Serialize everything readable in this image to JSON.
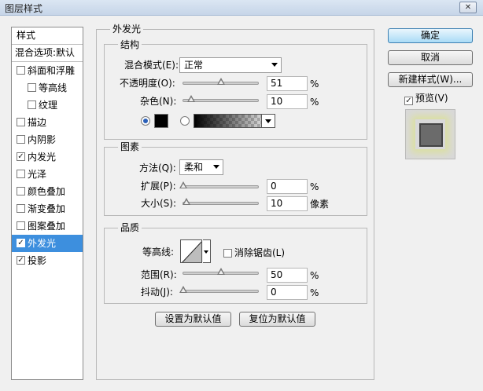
{
  "window": {
    "title": "图层样式",
    "close_icon": "close-icon"
  },
  "left_panel": {
    "header": "样式",
    "blending_options": "混合选项:默认",
    "items": [
      {
        "label": "斜面和浮雕",
        "checked": false
      },
      {
        "label": "等高线",
        "checked": false,
        "sub": true
      },
      {
        "label": "纹理",
        "checked": false,
        "sub": true
      },
      {
        "label": "描边",
        "checked": false
      },
      {
        "label": "内阴影",
        "checked": false
      },
      {
        "label": "内发光",
        "checked": true
      },
      {
        "label": "光泽",
        "checked": false
      },
      {
        "label": "颜色叠加",
        "checked": false
      },
      {
        "label": "渐变叠加",
        "checked": false
      },
      {
        "label": "图案叠加",
        "checked": false
      },
      {
        "label": "外发光",
        "checked": true,
        "selected": true
      },
      {
        "label": "投影",
        "checked": true
      }
    ],
    "check_mark": "✓"
  },
  "outer_glow": {
    "title": "外发光",
    "structure": {
      "title": "结构",
      "blend_mode_label": "混合模式(E):",
      "blend_mode_value": "正常",
      "opacity_label": "不透明度(O):",
      "opacity_value": "51",
      "opacity_unit": "%",
      "opacity_fraction": 0.51,
      "noise_label": "杂色(N):",
      "noise_value": "10",
      "noise_unit": "%",
      "noise_fraction": 0.1,
      "color_mode": "solid",
      "glow_color": "#000000"
    },
    "elements": {
      "title": "图素",
      "technique_label": "方法(Q):",
      "technique_value": "柔和",
      "spread_label": "扩展(P):",
      "spread_value": "0",
      "spread_unit": "%",
      "spread_fraction": 0.0,
      "size_label": "大小(S):",
      "size_value": "10",
      "size_unit": "像素",
      "size_fraction": 0.04
    },
    "quality": {
      "title": "品质",
      "contour_label": "等高线:",
      "antialias_label": "消除锯齿(L)",
      "antialias_checked": false,
      "range_label": "范围(R):",
      "range_value": "50",
      "range_unit": "%",
      "range_fraction": 0.5,
      "jitter_label": "抖动(J):",
      "jitter_value": "0",
      "jitter_unit": "%",
      "jitter_fraction": 0.0
    },
    "make_default": "设置为默认值",
    "reset_default": "复位为默认值"
  },
  "buttons": {
    "ok": "确定",
    "cancel": "取消",
    "new_style": "新建样式(W)...",
    "preview_label": "预览(V)",
    "preview_checked": true
  },
  "colors": {
    "selected_bg": "#3d8fde",
    "primary_button": "#a9dbf6",
    "glow_color": "#000000"
  }
}
